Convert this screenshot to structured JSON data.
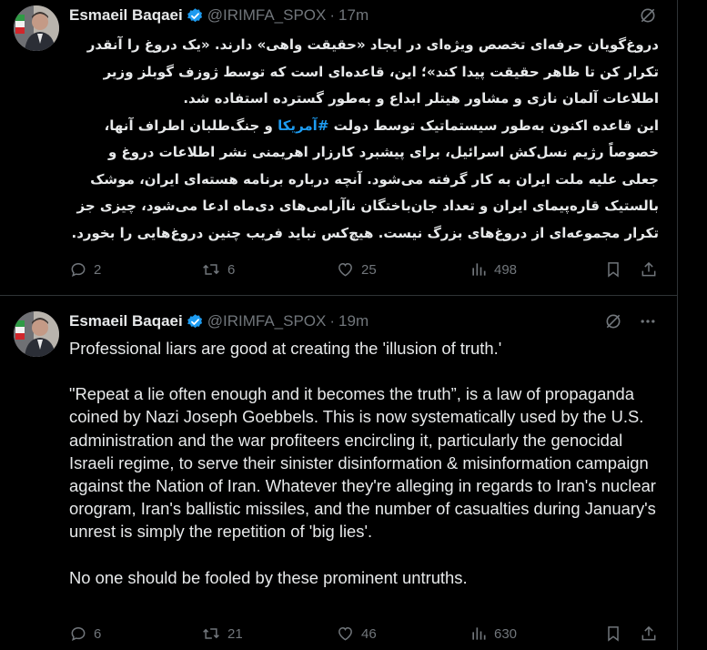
{
  "colors": {
    "background": "#000000",
    "text": "#e7e9ea",
    "muted": "#71767b",
    "divider": "#2f3336",
    "link": "#1d9bf0",
    "verified": "#1d9bf0"
  },
  "tweets": [
    {
      "author": "Esmaeil Baqaei",
      "handle": "@IRIMFA_SPOX",
      "separator": "·",
      "time": "17m",
      "avatar_icon": "profile-avatar-with-iran-flag",
      "paragraph_1": "دروغ‌گویان حرفه‌ای تخصص ویژه‌ای در ایجاد «حقیقت واهی» دارند. «یک دروغ را آنقدر تکرار کن تا ظاهر حقیقت پیدا کند»؛ این، قاعده‌ای است که توسط ژوزف گوبلز وزیر اطلاعات آلمان نازی و مشاور هیتلر ابداع و به‌طور گسترده استفاده شد.",
      "paragraph_2_before": "این قاعده اکنون به‌طور سیستماتیک توسط دولت ",
      "hashtag": "#آمریکا",
      "paragraph_2_after": " و جنگ‌طلبان اطراف آنها، خصوصاً رژیم نسل‌کش اسرائیل،  برای پیشبرد کارزار اهریمنی نشر اطلاعات دروغ و جعلی علیه ملت ایران به کار گرفته می‌شود. آنچه درباره برنامه هسته‌ای ایران، موشک بالستیک قاره‌پیمای ایران و تعداد جان‌باختگان ناآرامی‌های دی‌ماه ادعا می‌شود، چیزی جز تکرار مجموعه‌ای از دروغ‌های بزرگ نیست. هیچ‌کس نباید فریب چنین دروغ‌هایی را بخورد.",
      "replies": "2",
      "reposts": "6",
      "likes": "25",
      "views": "498"
    },
    {
      "author": "Esmaeil Baqaei",
      "handle": "@IRIMFA_SPOX",
      "separator": "·",
      "time": "19m",
      "avatar_icon": "profile-avatar-with-iran-flag",
      "paragraph_1": "Professional liars are good at creating the 'illusion of truth.'",
      "paragraph_2": "\"Repeat a lie often enough and it becomes the truth”, is a law of propaganda coined by Nazi Joseph Goebbels. This is now systematically used by the U.S. administration and the war profiteers encircling it, particularly the genocidal Israeli regime, to serve their sinister disinformation & misinformation campaign against the Nation of Iran. Whatever they're alleging in regards to Iran's nuclear orogram, Iran's ballistic missiles, and the number of casualties during January's unrest is simply the repetition of 'big lies'.",
      "paragraph_3": "No one should be fooled by these prominent untruths.",
      "replies": "6",
      "reposts": "21",
      "likes": "46",
      "views": "630"
    }
  ]
}
